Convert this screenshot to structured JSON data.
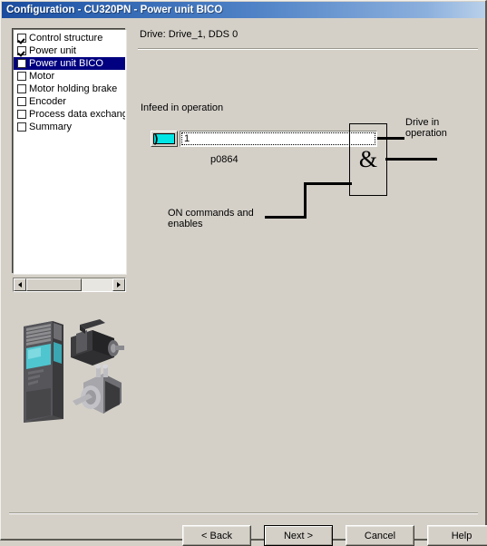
{
  "window": {
    "title": "Configuration - CU320PN - Power unit BICO"
  },
  "tree": {
    "items": [
      {
        "label": "Control structure",
        "checked": true,
        "selected": false
      },
      {
        "label": "Power unit",
        "checked": true,
        "selected": false
      },
      {
        "label": "Power unit BICO",
        "checked": false,
        "selected": true
      },
      {
        "label": "Motor",
        "checked": false,
        "selected": false
      },
      {
        "label": "Motor holding brake",
        "checked": false,
        "selected": false
      },
      {
        "label": "Encoder",
        "checked": false,
        "selected": false
      },
      {
        "label": "Process data exchang",
        "checked": false,
        "selected": false
      },
      {
        "label": "Summary",
        "checked": false,
        "selected": false
      }
    ]
  },
  "scrollbar": {
    "left_arrow": "scroll-left-icon",
    "right_arrow": "scroll-right-icon"
  },
  "content": {
    "drive_header": "Drive: Drive_1, DDS 0"
  },
  "diagram": {
    "infeed_label": "Infeed in operation",
    "parameter_label": "p0864",
    "bico_value": "1",
    "gate_symbol": "&",
    "on_commands_label": "ON commands and enables",
    "output_label": "Drive in operation",
    "bico_icon": "bico-connector-icon",
    "bico_icon_color": "#00e5e5"
  },
  "buttons": {
    "back": "< Back",
    "next": "Next >",
    "cancel": "Cancel",
    "help": "Help"
  },
  "colors": {
    "dialog_background": "#d4d0c8",
    "title_start": "#1b4c9e",
    "title_end": "#b9d0ea",
    "selection": "#000080"
  }
}
